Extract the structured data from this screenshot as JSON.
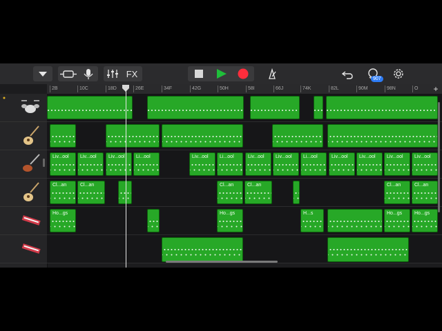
{
  "toolbar": {
    "fx_label": "FX",
    "notification_count": "907",
    "colors": {
      "play": "#1fbf3a",
      "record": "#ff2d3c",
      "accent": "#2d7cf6"
    }
  },
  "ruler": {
    "ticks": [
      "2B",
      "10C",
      "18D",
      "26E",
      "34F",
      "42G",
      "50H",
      "58I",
      "66J",
      "74K",
      "82L",
      "90M",
      "98N",
      "O"
    ]
  },
  "tracks": [
    {
      "instrument": "drum-kit-icon"
    },
    {
      "instrument": "acoustic-guitar-icon"
    },
    {
      "instrument": "electric-guitar-icon"
    },
    {
      "instrument": "acoustic-guitar-icon"
    },
    {
      "instrument": "keyboard-icon"
    },
    {
      "instrument": "keyboard-icon"
    }
  ],
  "region_labels": {
    "live_cool": "Liv...ool",
    "li_ool": "Li...ool",
    "clean": "Cl...an",
    "ho_gs": "Ho...gs",
    "h_s": "H...s"
  }
}
